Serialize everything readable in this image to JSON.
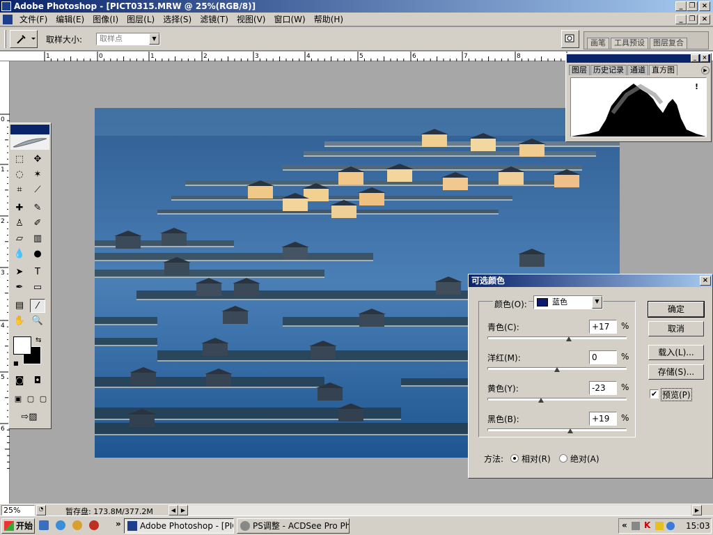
{
  "app": {
    "title": "Adobe Photoshop - [PICT0315.MRW @ 25%(RGB/8)]"
  },
  "menu": {
    "items": [
      "文件(F)",
      "编辑(E)",
      "图像(I)",
      "图层(L)",
      "选择(S)",
      "滤镜(T)",
      "视图(V)",
      "窗口(W)",
      "帮助(H)"
    ]
  },
  "options": {
    "sample_label": "取样大小:",
    "sample_value": "取样点",
    "palette_well_tabs": [
      "画笔",
      "工具预设",
      "图层复合"
    ]
  },
  "rulers": {
    "h_ticks": [
      "1",
      "0",
      "1",
      "2",
      "3",
      "4",
      "5",
      "6",
      "7",
      "8",
      "9"
    ],
    "v_ticks": [
      "0",
      "1",
      "2",
      "3",
      "4",
      "5",
      "6"
    ]
  },
  "panel": {
    "tabs": [
      "图层",
      "历史记录",
      "通道",
      "直方图"
    ],
    "active_tab": "直方图",
    "warning_icon": "!"
  },
  "dialog": {
    "title": "可选颜色",
    "color_label": "颜色(O):",
    "color_value": "蓝色",
    "swatch_color": "#0a1a6e",
    "sliders": [
      {
        "label": "青色(C):",
        "value": "+17",
        "unit": "%",
        "level": 0.585
      },
      {
        "label": "洋红(M):",
        "value": "0",
        "unit": "%",
        "level": 0.5
      },
      {
        "label": "黄色(Y):",
        "value": "-23",
        "unit": "%",
        "level": 0.385
      },
      {
        "label": "黑色(B):",
        "value": "+19",
        "unit": "%",
        "level": 0.595
      }
    ],
    "buttons": {
      "ok": "确定",
      "cancel": "取消",
      "load": "载入(L)...",
      "save": "存储(S)..."
    },
    "preview_label": "预览(P)",
    "preview_checked": true,
    "method_label": "方法:",
    "method_relative": "相对(R)",
    "method_absolute": "绝对(A)",
    "method_selected": "relative"
  },
  "status": {
    "zoom": "25%",
    "scratch": "暂存盘: 173.8M/377.2M"
  },
  "taskbar": {
    "start": "开始",
    "tasks": [
      "Adobe Photoshop - [PIC...",
      "PS调整 - ACDSee Pro Ph..."
    ],
    "clock": "15:03",
    "chevron": "»"
  }
}
